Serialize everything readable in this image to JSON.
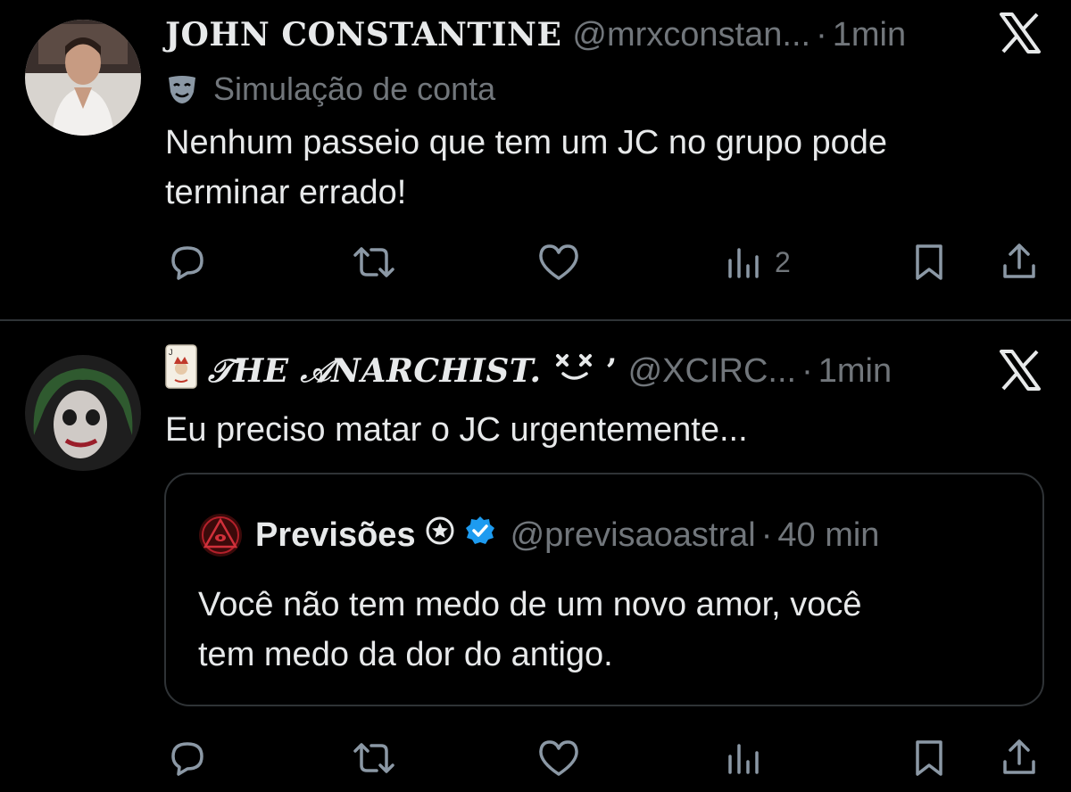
{
  "colors": {
    "background": "#000000",
    "text": "#e7e9ea",
    "muted": "#71767b",
    "verified": "#1d9bf0",
    "border": "#2f3336"
  },
  "tweets": [
    {
      "display_name": "JOHN CONSTANTINE",
      "handle": "@mrxconstan...",
      "separator": "·",
      "time": "1min",
      "label_icon": "theater-mask-icon",
      "label": "Simulação de conta",
      "text_line1": "Nenhum passeio que tem um JC no grupo pode",
      "text_line2": "terminar errado!",
      "views": "2"
    },
    {
      "display_name": "𝒯HE 𝒜NARCHIST.",
      "name_suffix": "’",
      "handle": "@XCIRC...",
      "separator": "·",
      "time": "1min",
      "text": "Eu preciso matar o JC urgentemente...",
      "quote": {
        "display_name": "Previsões",
        "handle": "@previsaoastral",
        "separator": "·",
        "time": "40 min",
        "text_line1": "Você não tem medo de um novo amor, você",
        "text_line2": "tem medo da dor do antigo."
      }
    }
  ]
}
